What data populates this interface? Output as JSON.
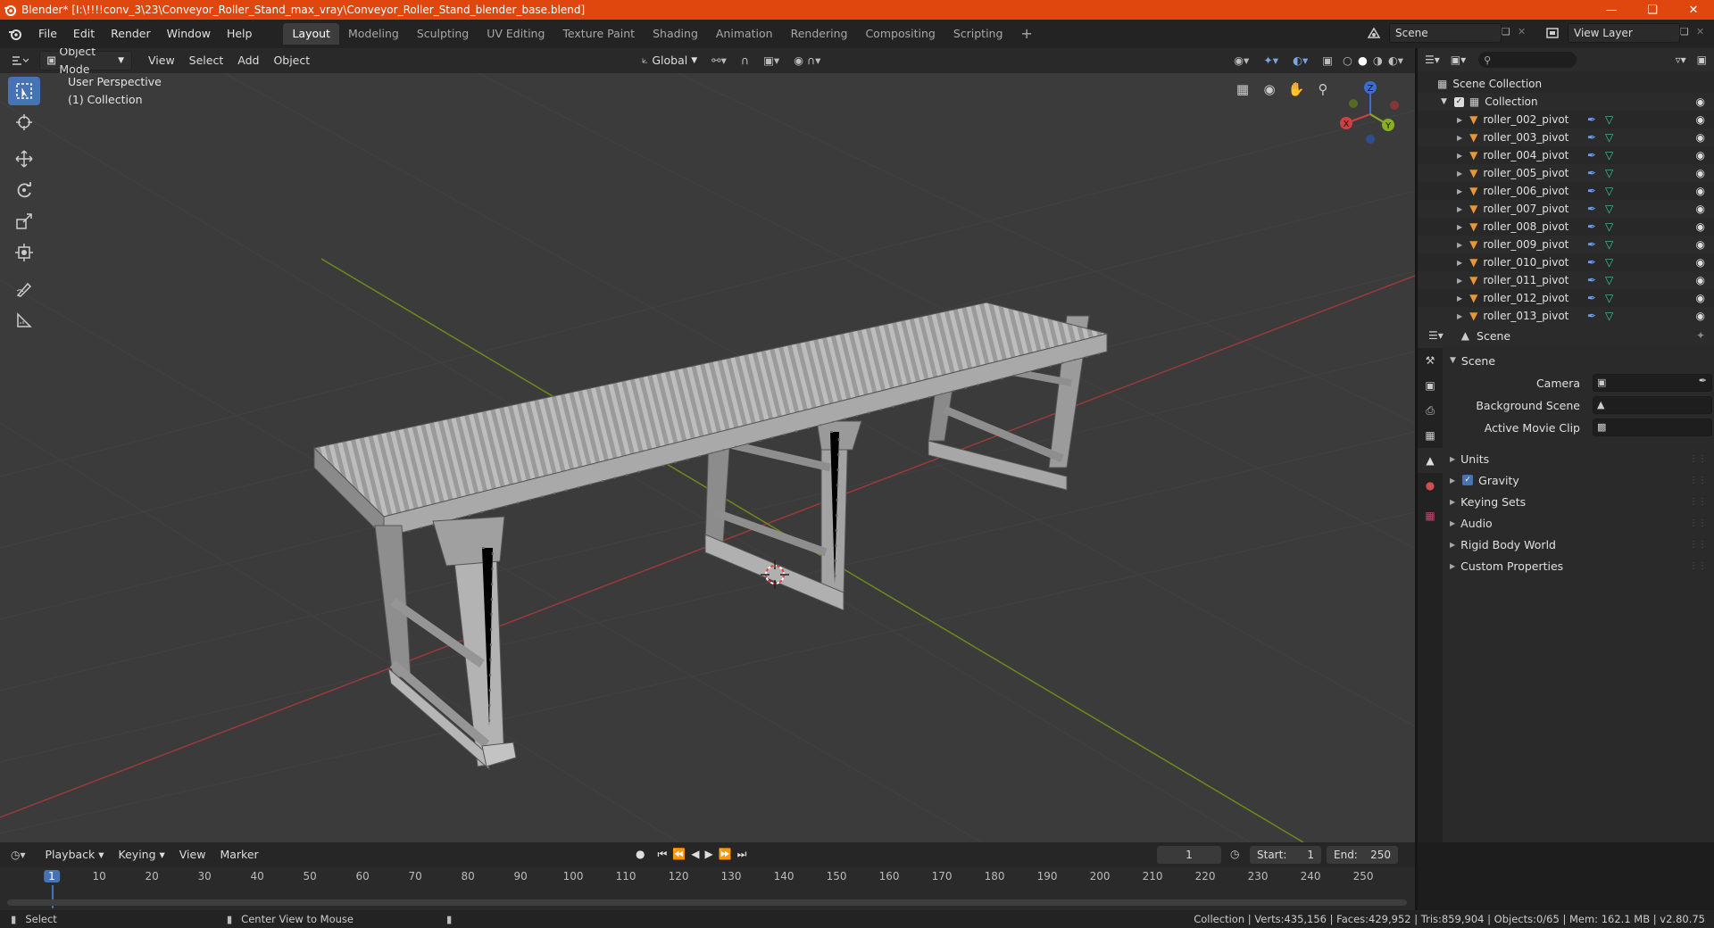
{
  "window": {
    "title": "Blender* [I:\\!!!!conv_3\\23\\Conveyor_Roller_Stand_max_vray\\Conveyor_Roller_Stand_blender_base.blend]"
  },
  "menubar": {
    "menus": [
      "File",
      "Edit",
      "Render",
      "Window",
      "Help"
    ],
    "workspaces": [
      "Layout",
      "Modeling",
      "Sculpting",
      "UV Editing",
      "Texture Paint",
      "Shading",
      "Animation",
      "Rendering",
      "Compositing",
      "Scripting"
    ],
    "active_workspace": "Layout",
    "scene": "Scene",
    "view_layer": "View Layer"
  },
  "viewport": {
    "mode": "Object Mode",
    "menus": [
      "View",
      "Select",
      "Add",
      "Object"
    ],
    "transform_orientation": "Global",
    "perspective_label": "User Perspective",
    "collection_label": "(1) Collection",
    "gizmo": {
      "x": "X",
      "y": "Y",
      "z": "Z"
    }
  },
  "outliner": {
    "scene_collection": "Scene Collection",
    "collection": "Collection",
    "items": [
      "roller_002_pivot",
      "roller_003_pivot",
      "roller_004_pivot",
      "roller_005_pivot",
      "roller_006_pivot",
      "roller_007_pivot",
      "roller_008_pivot",
      "roller_009_pivot",
      "roller_010_pivot",
      "roller_011_pivot",
      "roller_012_pivot",
      "roller_013_pivot"
    ]
  },
  "properties": {
    "context": "Scene",
    "section": "Scene",
    "camera_label": "Camera",
    "background_scene_label": "Background Scene",
    "active_movie_clip_label": "Active Movie Clip",
    "panels": [
      "Units",
      "Gravity",
      "Keying Sets",
      "Audio",
      "Rigid Body World",
      "Custom Properties"
    ]
  },
  "timeline": {
    "menus": [
      "Playback",
      "Keying",
      "View",
      "Marker"
    ],
    "current_frame": "1",
    "start_label": "Start:",
    "start": "1",
    "end_label": "End:",
    "end": "250",
    "ticks": [
      "1",
      "10",
      "20",
      "30",
      "40",
      "50",
      "60",
      "70",
      "80",
      "90",
      "100",
      "110",
      "120",
      "130",
      "140",
      "150",
      "160",
      "170",
      "180",
      "190",
      "200",
      "210",
      "220",
      "230",
      "240",
      "250"
    ]
  },
  "statusbar": {
    "select": "Select",
    "center_view": "Center View to Mouse",
    "stats": "Collection | Verts:435,156 | Faces:429,952 | Tris:859,904 | Objects:0/65 | Mem: 162.1 MB | v2.80.75"
  },
  "colors": {
    "title_bar": "#e0470f",
    "accent": "#4772b3",
    "object_orange": "#e8963c",
    "mesh_green": "#3ec9a0"
  }
}
